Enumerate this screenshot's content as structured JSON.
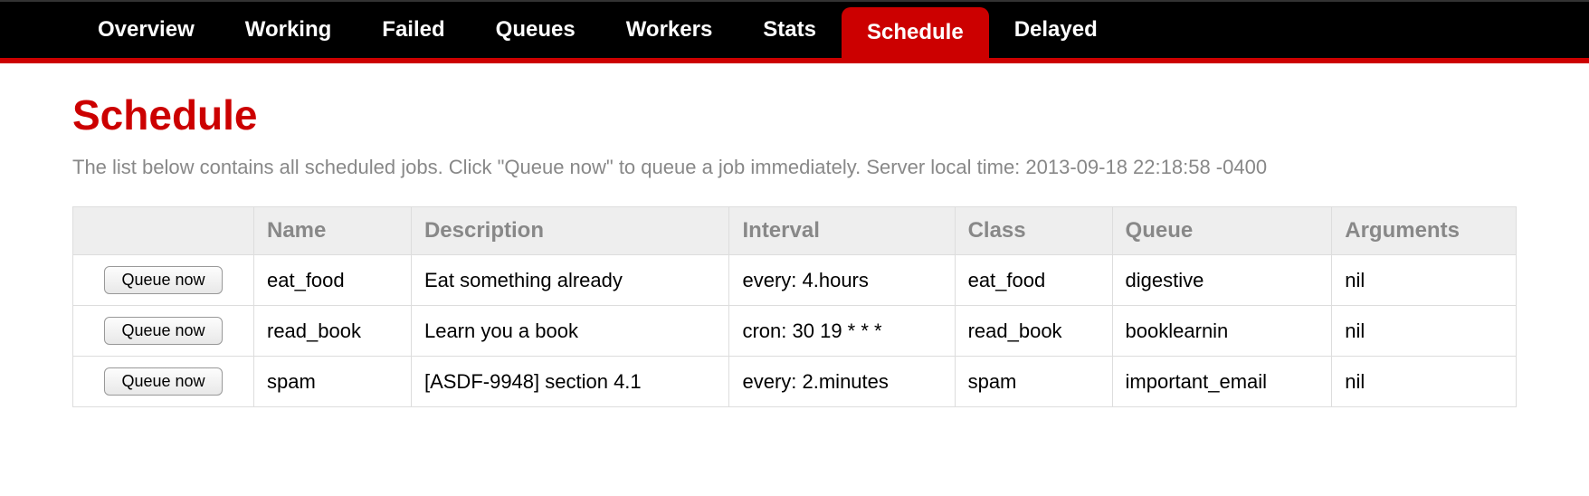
{
  "nav": {
    "items": [
      {
        "label": "Overview",
        "active": false
      },
      {
        "label": "Working",
        "active": false
      },
      {
        "label": "Failed",
        "active": false
      },
      {
        "label": "Queues",
        "active": false
      },
      {
        "label": "Workers",
        "active": false
      },
      {
        "label": "Stats",
        "active": false
      },
      {
        "label": "Schedule",
        "active": true
      },
      {
        "label": "Delayed",
        "active": false
      }
    ]
  },
  "page": {
    "title": "Schedule",
    "description": "The list below contains all scheduled jobs. Click \"Queue now\" to queue a job immediately. Server local time: 2013-09-18 22:18:58 -0400"
  },
  "table": {
    "action_button_label": "Queue now",
    "headers": {
      "action": "",
      "name": "Name",
      "description": "Description",
      "interval": "Interval",
      "class": "Class",
      "queue": "Queue",
      "arguments": "Arguments"
    },
    "rows": [
      {
        "name": "eat_food",
        "description": "Eat something already",
        "interval": "every: 4.hours",
        "class": "eat_food",
        "queue": "digestive",
        "arguments": "nil"
      },
      {
        "name": "read_book",
        "description": "Learn you a book",
        "interval": "cron: 30 19 * * *",
        "class": "read_book",
        "queue": "booklearnin",
        "arguments": "nil"
      },
      {
        "name": "spam",
        "description": "[ASDF-9948] section 4.1",
        "interval": "every: 2.minutes",
        "class": "spam",
        "queue": "important_email",
        "arguments": "nil"
      }
    ]
  }
}
